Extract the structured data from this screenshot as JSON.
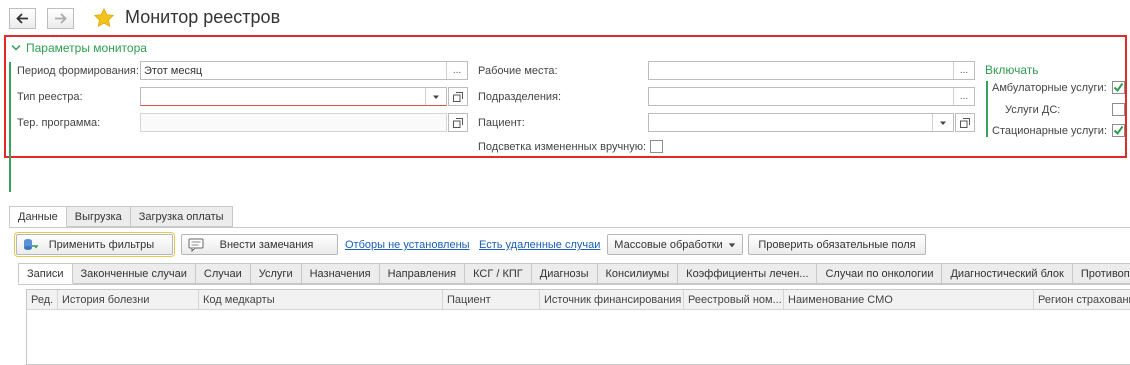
{
  "window": {
    "title": "Монитор реестров"
  },
  "params": {
    "header": "Параметры монитора",
    "period_label": "Период формирования:",
    "period_value": "Этот месяц",
    "registry_type_label": "Тип реестра:",
    "ter_program_label": "Тер. программа:",
    "workplaces_label": "Рабочие места:",
    "departments_label": "Подразделения:",
    "patient_label": "Пациент:",
    "highlight_label": "Подсветка измененных вручную:",
    "highlight_checked": false,
    "ellipsis": "...",
    "include": {
      "title": "Включать",
      "items": [
        {
          "label": "Амбулаторные услуги:",
          "checked": true
        },
        {
          "label": "Услуги ДС:",
          "checked": false
        },
        {
          "label": "Стационарные услуги:",
          "checked": true
        }
      ]
    }
  },
  "top_tabs": [
    "Данные",
    "Выгрузка",
    "Загрузка оплаты"
  ],
  "toolbar": {
    "apply_filters": "Применить фильтры",
    "add_remarks": "Внести замечания",
    "filters_link": "Отборы не установлены",
    "deleted_link": "Есть удаленные случаи",
    "mass_processing": "Массовые обработки",
    "check_fields": "Проверить обязательные поля"
  },
  "sub_tabs": [
    "Записи",
    "Законченные случаи",
    "Случаи",
    "Услуги",
    "Назначения",
    "Направления",
    "КСГ / КПГ",
    "Диагнозы",
    "Консилиумы",
    "Коэффициенты лечен...",
    "Случаи по онкологии",
    "Диагностический блок",
    "Противопо"
  ],
  "table": {
    "columns": [
      "Ред.",
      "История болезни",
      "Код медкарты",
      "Пациент",
      "Источник финансирования",
      "Реестровый ном...",
      "Наименование СМО",
      "Регион страховани"
    ]
  },
  "colors": {
    "accent_green": "#2e9e4f",
    "frame_red": "#e12a2a",
    "link_blue": "#1a5fb4",
    "star_yellow": "#f4c21b"
  }
}
